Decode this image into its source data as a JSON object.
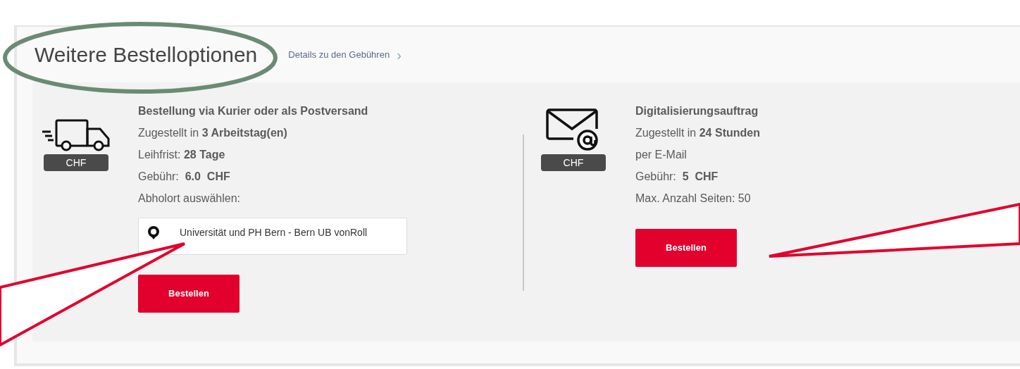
{
  "section": {
    "title": "Weitere Bestelloptionen",
    "fees_link": "Details zu den Gebühren",
    "link_chevron": "›"
  },
  "options": [
    {
      "kind": "courier",
      "currency_badge": "CHF",
      "title": "Bestellung via Kurier oder als Postversand",
      "lines": [
        "Zugestellt in **3 Arbeitstag(en)**",
        "Leihfrist: **28 Tage**",
        "Gebühr:  **6.0  CHF**",
        "Abholort auswählen:"
      ],
      "pickup_field": {
        "value": "Universität und PH Bern - Bern UB vonRoll"
      },
      "button": "Bestellen"
    },
    {
      "kind": "digital",
      "currency_badge": "CHF",
      "title": "Digitalisierungsauftrag",
      "lines": [
        "Zugestellt in **24 Stunden**",
        "per E-Mail",
        "Gebühr:  **5  CHF**",
        "Max. Anzahl Seiten: 50"
      ],
      "button": "Bestellen"
    }
  ]
}
